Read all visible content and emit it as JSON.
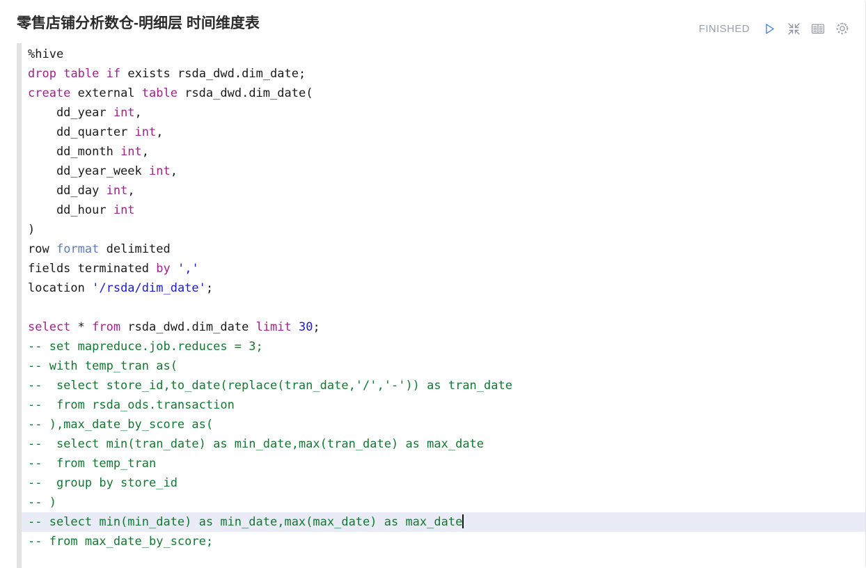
{
  "paragraph": {
    "title": "零售店铺分析数仓-明细层 时间维度表",
    "status": "FINISHED",
    "controls": [
      {
        "name": "run-paragraph-button",
        "icon": "play-icon",
        "label": "Run"
      },
      {
        "name": "collapse-paragraph-button",
        "icon": "minimize-arrows-icon",
        "label": "Collapse"
      },
      {
        "name": "book-view-button",
        "icon": "book-icon",
        "label": "Book"
      },
      {
        "name": "settings-button",
        "icon": "gear-icon",
        "label": "Settings"
      }
    ]
  },
  "editor": {
    "language": "hive",
    "cursor_line": 26,
    "highlight_color": "#e9ebf7",
    "syntax_colors": {
      "keyword": "#a0228c",
      "string": "#1a1ad0",
      "number": "#1a1ad0",
      "comment": "#12782f",
      "function": "#5f7cb5",
      "plain": "#1a1a1a"
    },
    "lines": [
      {
        "tokens": [
          {
            "t": "%hive",
            "c": "plain"
          }
        ]
      },
      {
        "tokens": [
          {
            "t": "drop",
            "c": "kw"
          },
          {
            "t": " ",
            "c": "plain"
          },
          {
            "t": "table",
            "c": "kw"
          },
          {
            "t": " ",
            "c": "plain"
          },
          {
            "t": "if",
            "c": "kw"
          },
          {
            "t": " exists rsda_dwd.dim_date;",
            "c": "plain"
          }
        ]
      },
      {
        "tokens": [
          {
            "t": "create",
            "c": "kw"
          },
          {
            "t": " external ",
            "c": "plain"
          },
          {
            "t": "table",
            "c": "kw"
          },
          {
            "t": " rsda_dwd.dim_date(",
            "c": "plain"
          }
        ]
      },
      {
        "tokens": [
          {
            "t": "    dd_year ",
            "c": "plain"
          },
          {
            "t": "int",
            "c": "kw"
          },
          {
            "t": ",",
            "c": "plain"
          }
        ]
      },
      {
        "tokens": [
          {
            "t": "    dd_quarter ",
            "c": "plain"
          },
          {
            "t": "int",
            "c": "kw"
          },
          {
            "t": ",",
            "c": "plain"
          }
        ]
      },
      {
        "tokens": [
          {
            "t": "    dd_month ",
            "c": "plain"
          },
          {
            "t": "int",
            "c": "kw"
          },
          {
            "t": ",",
            "c": "plain"
          }
        ]
      },
      {
        "tokens": [
          {
            "t": "    dd_year_week ",
            "c": "plain"
          },
          {
            "t": "int",
            "c": "kw"
          },
          {
            "t": ",",
            "c": "plain"
          }
        ]
      },
      {
        "tokens": [
          {
            "t": "    dd_day ",
            "c": "plain"
          },
          {
            "t": "int",
            "c": "kw"
          },
          {
            "t": ",",
            "c": "plain"
          }
        ]
      },
      {
        "tokens": [
          {
            "t": "    dd_hour ",
            "c": "plain"
          },
          {
            "t": "int",
            "c": "kw"
          }
        ]
      },
      {
        "tokens": [
          {
            "t": ")",
            "c": "plain"
          }
        ]
      },
      {
        "tokens": [
          {
            "t": "row ",
            "c": "plain"
          },
          {
            "t": "format",
            "c": "fn"
          },
          {
            "t": " delimited",
            "c": "plain"
          }
        ]
      },
      {
        "tokens": [
          {
            "t": "fields terminated ",
            "c": "plain"
          },
          {
            "t": "by",
            "c": "kw"
          },
          {
            "t": " ",
            "c": "plain"
          },
          {
            "t": "','",
            "c": "str"
          }
        ]
      },
      {
        "tokens": [
          {
            "t": "location ",
            "c": "plain"
          },
          {
            "t": "'/rsda/dim_date'",
            "c": "str"
          },
          {
            "t": ";",
            "c": "plain"
          }
        ]
      },
      {
        "tokens": [
          {
            "t": "",
            "c": "plain"
          }
        ]
      },
      {
        "tokens": [
          {
            "t": "select",
            "c": "kw"
          },
          {
            "t": " * ",
            "c": "plain"
          },
          {
            "t": "from",
            "c": "kw"
          },
          {
            "t": " rsda_dwd.dim_date ",
            "c": "plain"
          },
          {
            "t": "limit",
            "c": "kw"
          },
          {
            "t": " ",
            "c": "plain"
          },
          {
            "t": "30",
            "c": "num"
          },
          {
            "t": ";",
            "c": "plain"
          }
        ]
      },
      {
        "tokens": [
          {
            "t": "-- set mapreduce.job.reduces = 3;",
            "c": "cmt"
          }
        ]
      },
      {
        "tokens": [
          {
            "t": "-- with temp_tran as(",
            "c": "cmt"
          }
        ]
      },
      {
        "tokens": [
          {
            "t": "--  select store_id,to_date(replace(tran_date,'/','-')) as tran_date",
            "c": "cmt"
          }
        ]
      },
      {
        "tokens": [
          {
            "t": "--  from rsda_ods.transaction",
            "c": "cmt"
          }
        ]
      },
      {
        "tokens": [
          {
            "t": "-- ),max_date_by_score as(",
            "c": "cmt"
          }
        ]
      },
      {
        "tokens": [
          {
            "t": "--  select min(tran_date) as min_date,max(tran_date) as max_date",
            "c": "cmt"
          }
        ]
      },
      {
        "tokens": [
          {
            "t": "--  from temp_tran",
            "c": "cmt"
          }
        ]
      },
      {
        "tokens": [
          {
            "t": "--  group by store_id",
            "c": "cmt"
          }
        ]
      },
      {
        "tokens": [
          {
            "t": "-- )",
            "c": "cmt"
          }
        ]
      },
      {
        "tokens": [
          {
            "t": "-- select min(min_date) as min_date,max(max_date) as max_date",
            "c": "cmt"
          }
        ],
        "highlight": true,
        "caret": true
      },
      {
        "tokens": [
          {
            "t": "-- from max_date_by_score;",
            "c": "cmt"
          }
        ]
      }
    ]
  }
}
